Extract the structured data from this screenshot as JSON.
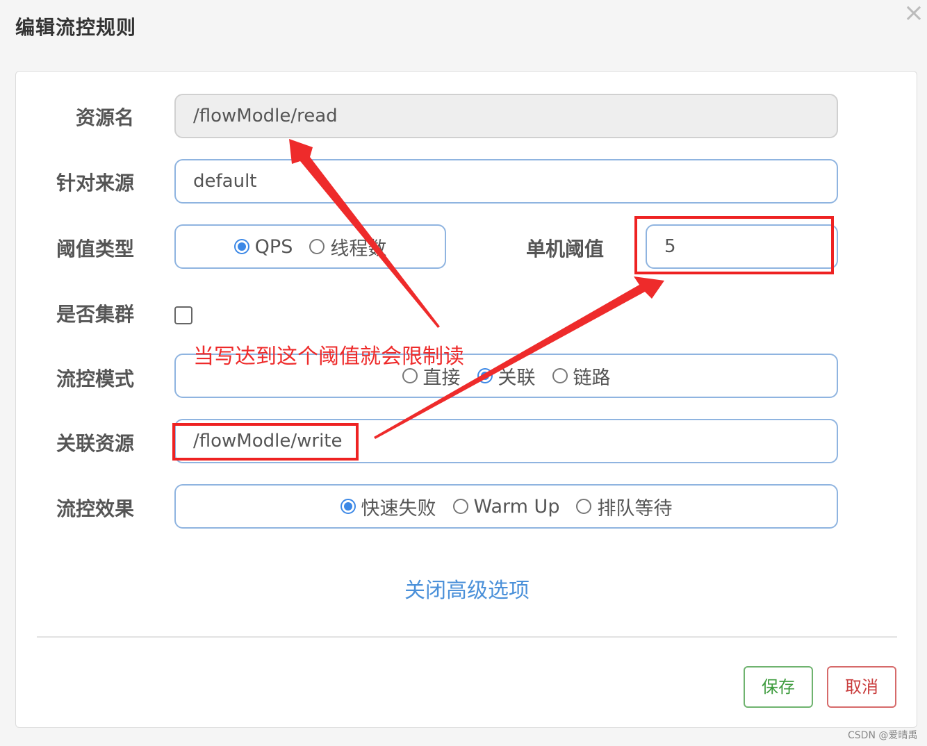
{
  "dialog": {
    "title": "编辑流控规则",
    "close_label": "×"
  },
  "form": {
    "resource_name": {
      "label": "资源名",
      "value": "/flowModle/read"
    },
    "limit_app": {
      "label": "针对来源",
      "value": "default"
    },
    "threshold_type": {
      "label": "阈值类型",
      "options": [
        {
          "label": "QPS",
          "checked": true
        },
        {
          "label": "线程数",
          "checked": false
        }
      ]
    },
    "single_threshold": {
      "label": "单机阈值",
      "value": "5"
    },
    "cluster": {
      "label": "是否集群",
      "checked": false
    },
    "flow_mode": {
      "label": "流控模式",
      "options": [
        {
          "label": "直接",
          "checked": false
        },
        {
          "label": "关联",
          "checked": true
        },
        {
          "label": "链路",
          "checked": false
        }
      ]
    },
    "ref_resource": {
      "label": "关联资源",
      "value": "/flowModle/write"
    },
    "control_behavior": {
      "label": "流控效果",
      "options": [
        {
          "label": "快速失败",
          "checked": true
        },
        {
          "label": "Warm Up",
          "checked": false
        },
        {
          "label": "排队等待",
          "checked": false
        }
      ]
    },
    "advanced_toggle": "关闭高级选项"
  },
  "buttons": {
    "save": "保存",
    "cancel": "取消"
  },
  "annotation": {
    "text": "当写达到这个阈值就会限制读",
    "color": "#ee2b2b"
  },
  "watermark": "CSDN @爱晴禹",
  "colors": {
    "accent": "#3c88e6",
    "field_border": "#8fb4e0",
    "link": "#4a90d9",
    "save": "#3f9c3f",
    "cancel": "#c93c3c"
  }
}
